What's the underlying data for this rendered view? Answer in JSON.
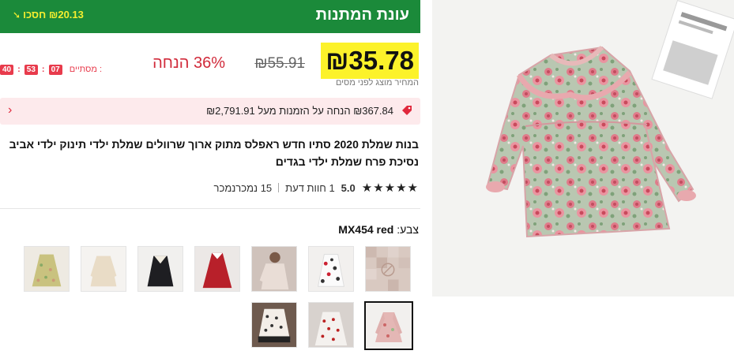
{
  "promo": {
    "title": "עונת המתנות",
    "save_text": "₪20.13 חסכו",
    "arrow": "➘"
  },
  "price": {
    "current": "₪35.78",
    "original": "₪55.91",
    "discount": "36% הנחה",
    "tax_note": "המחיר מוצג לפני מסים"
  },
  "countdown": {
    "label": "מסתיים :",
    "hours": "07",
    "minutes": "53",
    "seconds": "40"
  },
  "coupon": {
    "text": "₪367.84 הנחה על הזמנות מעל ₪2,791.91"
  },
  "product": {
    "title": "בנות שמלת 2020 סתיו חדש ראפלס מתוק ארוך שרוולים שמלת ילדי תינוק ילדי אביב נסיכת פרח שמלת ילדי בגדים"
  },
  "rating": {
    "stars": "★★★★★",
    "value": "5.0",
    "reviews": "1 חוות דעת",
    "sold": "15 נמכרנמכר"
  },
  "color": {
    "label": "צבע:",
    "value": "MX454 red"
  },
  "colors": {
    "accent_green": "#1b8a3a",
    "accent_red": "#e0283c",
    "highlight": "#fcf22a"
  },
  "thumbnails": [
    {
      "name": "thumb-placeholder"
    },
    {
      "name": "thumb-white-print"
    },
    {
      "name": "thumb-pink-gray"
    },
    {
      "name": "thumb-red"
    },
    {
      "name": "thumb-black"
    },
    {
      "name": "thumb-cream"
    },
    {
      "name": "thumb-yellow-floral"
    },
    {
      "name": "thumb-pink-floral-selected",
      "selected": true
    },
    {
      "name": "thumb-white-dots"
    },
    {
      "name": "thumb-black-white-dots"
    }
  ]
}
